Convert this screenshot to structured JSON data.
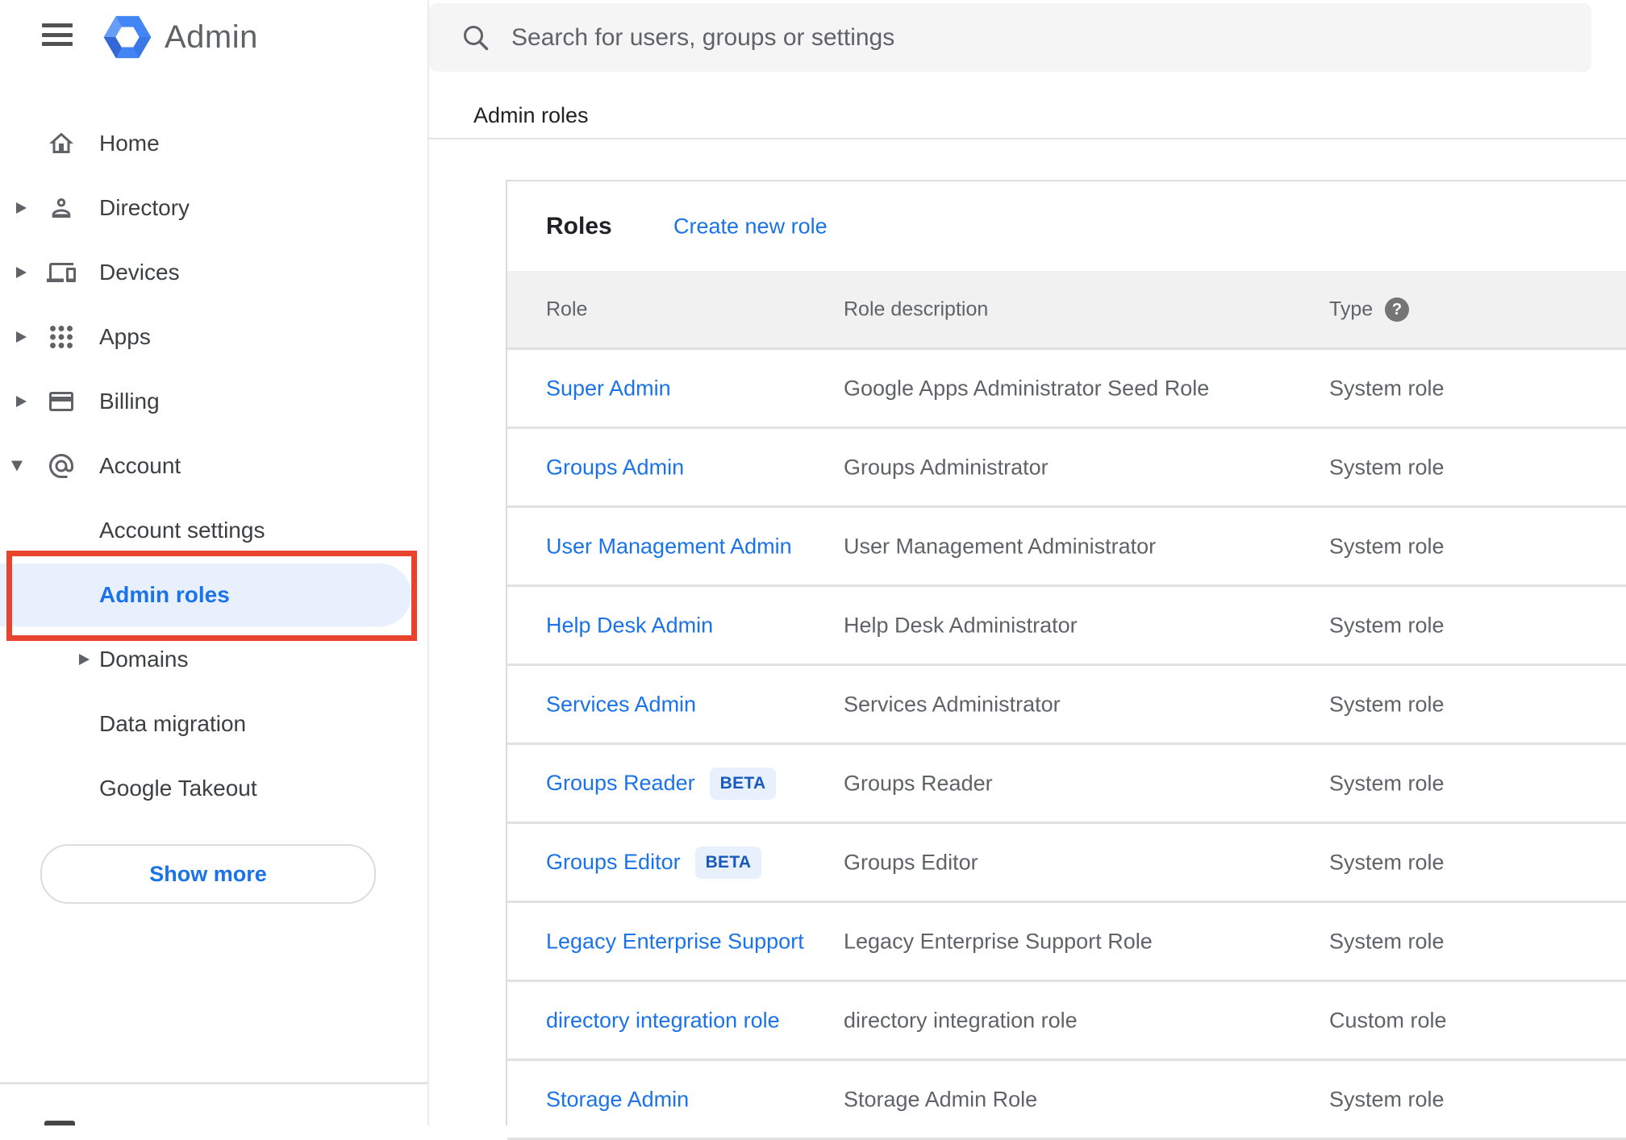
{
  "header": {
    "app_title": "Admin",
    "search_placeholder": "Search for users, groups or settings"
  },
  "sidebar": {
    "items": [
      {
        "label": "Home",
        "icon": "home-icon",
        "expandable": false
      },
      {
        "label": "Directory",
        "icon": "person-icon",
        "expandable": true
      },
      {
        "label": "Devices",
        "icon": "devices-icon",
        "expandable": true
      },
      {
        "label": "Apps",
        "icon": "apps-grid-icon",
        "expandable": true
      },
      {
        "label": "Billing",
        "icon": "credit-card-icon",
        "expandable": true
      },
      {
        "label": "Account",
        "icon": "at-email-icon",
        "expandable": true,
        "expanded": true
      }
    ],
    "account_subitems": [
      {
        "label": "Account settings",
        "selected": false
      },
      {
        "label": "Admin roles",
        "selected": true
      },
      {
        "label": "Domains",
        "selected": false,
        "expandable": true
      },
      {
        "label": "Data migration",
        "selected": false
      },
      {
        "label": "Google Takeout",
        "selected": false
      }
    ],
    "show_more_label": "Show more"
  },
  "page": {
    "breadcrumb": "Admin roles"
  },
  "roles_card": {
    "title": "Roles",
    "create_link_label": "Create new role",
    "beta_label": "BETA",
    "columns": [
      "Role",
      "Role description",
      "Type"
    ],
    "rows": [
      {
        "role": "Super Admin",
        "beta": false,
        "description": "Google Apps Administrator Seed Role",
        "type": "System role"
      },
      {
        "role": "Groups Admin",
        "beta": false,
        "description": "Groups Administrator",
        "type": "System role"
      },
      {
        "role": "User Management Admin",
        "beta": false,
        "description": "User Management Administrator",
        "type": "System role"
      },
      {
        "role": "Help Desk Admin",
        "beta": false,
        "description": "Help Desk Administrator",
        "type": "System role"
      },
      {
        "role": "Services Admin",
        "beta": false,
        "description": "Services Administrator",
        "type": "System role"
      },
      {
        "role": "Groups Reader",
        "beta": true,
        "description": "Groups Reader",
        "type": "System role"
      },
      {
        "role": "Groups Editor",
        "beta": true,
        "description": "Groups Editor",
        "type": "System role"
      },
      {
        "role": "Legacy Enterprise Support",
        "beta": false,
        "description": "Legacy Enterprise Support Role",
        "type": "System role"
      },
      {
        "role": "directory integration role",
        "beta": false,
        "description": "directory integration role",
        "type": "Custom role"
      },
      {
        "role": "Storage Admin",
        "beta": false,
        "description": "Storage Admin Role",
        "type": "System role"
      }
    ]
  },
  "colors": {
    "link_blue": "#1a73e8",
    "selected_item_bg": "#e8f0fe",
    "beta_badge_bg": "#e8f0fe",
    "beta_badge_text": "#185abc",
    "table_header_bg": "#f1f1f1",
    "annotation_red": "#e8442d",
    "logo_blue": "#4285f4"
  }
}
